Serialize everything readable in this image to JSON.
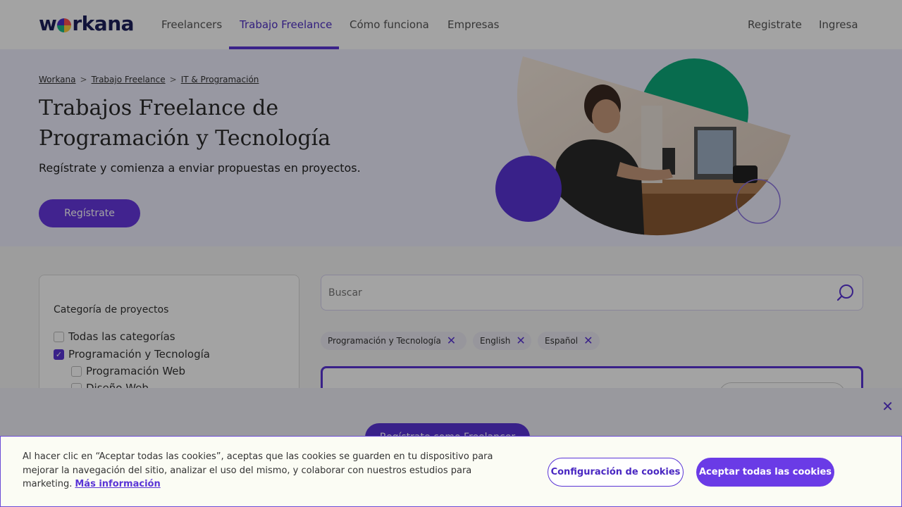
{
  "brand": {
    "logo_text_left": "w",
    "logo_text_right": "rkana"
  },
  "nav": {
    "links": [
      "Freelancers",
      "Trabajo Freelance",
      "Cómo funciona",
      "Empresas"
    ],
    "right_links": [
      "Registrate",
      "Ingresa"
    ]
  },
  "hero": {
    "breadcrumb": [
      "Workana",
      "Trabajo Freelance",
      "IT & Programación"
    ],
    "breadcrumb_sep": ">",
    "title": "Trabajos Freelance de Programación y Tecnología",
    "subtitle": "Regístrate y comienza a enviar propuestas en proyectos.",
    "cta": "Regístrate"
  },
  "sidebar": {
    "title": "Categoría de proyectos",
    "items": [
      {
        "label": "Todas las categorías",
        "checked": false
      },
      {
        "label": "Programación y Tecnología",
        "checked": true
      },
      {
        "label": "Programación Web",
        "checked": false
      },
      {
        "label": "Diseño Web",
        "checked": false
      }
    ]
  },
  "search": {
    "placeholder": "Buscar"
  },
  "filters": [
    "Programación y Tecnología",
    "English",
    "Español"
  ],
  "register_bar": {
    "button": "Regístrate como Freelancer",
    "close": "✕"
  },
  "cookie": {
    "text": "Al hacer clic en “Aceptar todas las cookies”, aceptas que las cookies se guarden en tu dispositivo para mejorar la navegación del sitio, analizar el uso del mismo, y colaborar con nuestros estudios para marketing.",
    "more_link": "Más información",
    "settings_button": "Configuración de cookies",
    "accept_button": "Aceptar todas las cookies"
  },
  "colors": {
    "brand_purple": "#5a35d6",
    "accent_green": "#0ea97a",
    "hero_bg": "#eeeefe"
  }
}
